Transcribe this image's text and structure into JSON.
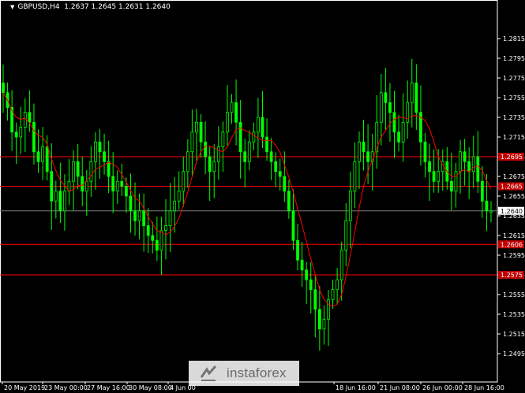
{
  "window": {
    "symbol_timeframe": "GBPUSD,H4",
    "ohlc": "1.2637 1.2645 1.2631 1.2640"
  },
  "logo_text": "instaforex",
  "colors": {
    "background": "#000000",
    "candle": "#00ff00",
    "moving_average": "#ff0000",
    "level_line": "#ff0000",
    "price_box": "#c00000",
    "text": "#ffffff"
  },
  "chart_data": {
    "type": "candlestick",
    "ylim": [
      1.2495,
      1.2835
    ],
    "y_ticks": [
      "1.2815",
      "1.2795",
      "1.2775",
      "1.2755",
      "1.2735",
      "1.2715",
      "1.2695",
      "1.2675",
      "1.2655",
      "1.2635",
      "1.2615",
      "1.2595",
      "1.2575",
      "1.2555",
      "1.2535",
      "1.2515",
      "1.2495"
    ],
    "x_ticks": [
      "20 May 2019",
      "23 May 00:00",
      "27 May 16:00",
      "30 May 08:00",
      "4 Jun 00",
      "18 Jun 16:00",
      "21 Jun 08:00",
      "26 Jun 00:00",
      "28 Jun 16:00"
    ],
    "levels": [
      {
        "label": "1.2695",
        "value": 1.2695
      },
      {
        "label": "1.2665",
        "value": 1.2665
      },
      {
        "label": "1.2606",
        "value": 1.2606
      },
      {
        "label": "1.2575",
        "value": 1.2575
      }
    ],
    "current_price": {
      "label": "1.2640",
      "value": 1.264
    },
    "closes": [
      1.276,
      1.2745,
      1.272,
      1.2715,
      1.2725,
      1.274,
      1.273,
      1.27,
      1.269,
      1.2705,
      1.268,
      1.265,
      1.266,
      1.264,
      1.266,
      1.267,
      1.269,
      1.2675,
      1.266,
      1.267,
      1.269,
      1.271,
      1.27,
      1.269,
      1.2675,
      1.266,
      1.267,
      1.2665,
      1.2655,
      1.264,
      1.263,
      1.264,
      1.2625,
      1.2615,
      1.261,
      1.26,
      1.262,
      1.2625,
      1.264,
      1.265,
      1.266,
      1.268,
      1.27,
      1.272,
      1.273,
      1.271,
      1.2695,
      1.268,
      1.269,
      1.2705,
      1.272,
      1.274,
      1.275,
      1.273,
      1.27,
      1.269,
      1.271,
      1.272,
      1.2735,
      1.2715,
      1.27,
      1.269,
      1.268,
      1.2675,
      1.266,
      1.264,
      1.261,
      1.259,
      1.258,
      1.257,
      1.256,
      1.254,
      1.252,
      1.253,
      1.255,
      1.256,
      1.257,
      1.26,
      1.263,
      1.266,
      1.269,
      1.271,
      1.27,
      1.269,
      1.27,
      1.273,
      1.276,
      1.275,
      1.274,
      1.272,
      1.271,
      1.273,
      1.275,
      1.277,
      1.274,
      1.271,
      1.269,
      1.268,
      1.267,
      1.268,
      1.269,
      1.267,
      1.266,
      1.268,
      1.27,
      1.269,
      1.268,
      1.2695,
      1.267,
      1.265,
      1.264,
      1.264
    ]
  }
}
